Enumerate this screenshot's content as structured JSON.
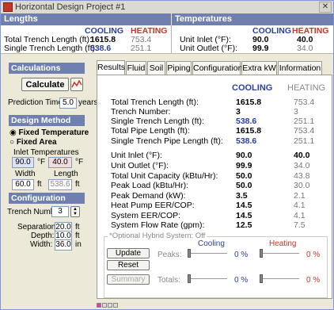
{
  "window": {
    "title": "Horizontal Design Project #1",
    "close_label": "✕"
  },
  "summary": {
    "lengths_header": "Lengths",
    "temps_header": "Temperatures",
    "cooling_label": "COOLING",
    "heating_label": "HEATING",
    "total_trench_label": "Total Trench Length (ft):",
    "total_trench_cool": "1615.8",
    "total_trench_heat": "753.4",
    "single_trench_label": "Single Trench Length (ft):",
    "single_trench_cool": "538.6",
    "single_trench_heat": "251.1",
    "unit_inlet_label": "Unit Inlet (°F):",
    "unit_inlet_cool": "90.0",
    "unit_inlet_heat": "40.0",
    "unit_outlet_label": "Unit Outlet (°F):",
    "unit_outlet_cool": "99.9",
    "unit_outlet_heat": "34.0"
  },
  "left": {
    "calculations_header": "Calculations",
    "calculate_label": "Calculate",
    "prediction_label": "Prediction Time:",
    "prediction_value": "5.0",
    "prediction_unit": "years",
    "design_method_header": "Design Method",
    "fixed_temperature": "Fixed Temperature",
    "fixed_area": "Fixed Area",
    "inlet_temps_label": "Inlet Temperatures",
    "inlet_cool": "90.0",
    "inlet_heat": "40.0",
    "deg_unit": "°F",
    "width_label": "Width",
    "length_label": "Length",
    "width_value": "60.0",
    "length_value": "538.6",
    "ft_unit": "ft",
    "configuration_header": "Configuration",
    "trench_number_label": "Trench Number:",
    "trench_number_value": "3",
    "separation_label": "Separation:",
    "separation_value": "20.0",
    "depth_label": "Depth:",
    "depth_value": "10.0",
    "width2_label": "Width:",
    "width2_value": "36.0",
    "in_unit": "in"
  },
  "tabs": [
    "Results",
    "Fluid",
    "Soil",
    "Piping",
    "Configuration",
    "Extra kW",
    "Information"
  ],
  "results": {
    "cooling_header": "COOLING",
    "heating_header": "HEATING",
    "rows": [
      {
        "label": "Total Trench Length (ft):",
        "cool": "1615.8",
        "heat": "753.4"
      },
      {
        "label": "Trench Number:",
        "cool": "3",
        "heat": "3"
      },
      {
        "label": "Single Trench Length (ft):",
        "cool": "538.6",
        "heat": "251.1"
      },
      {
        "label": "Total Pipe Length (ft):",
        "cool": "1615.8",
        "heat": "753.4"
      },
      {
        "label": "Single Trench Pipe Length (ft):",
        "cool": "538.6",
        "heat": "251.1"
      },
      {
        "label": "Unit Inlet (°F):",
        "cool": "90.0",
        "heat": "40.0"
      },
      {
        "label": "Unit Outlet (°F):",
        "cool": "99.9",
        "heat": "34.0"
      },
      {
        "label": "Total Unit Capacity (kBtu/Hr):",
        "cool": "50.0",
        "heat": "43.8"
      },
      {
        "label": "Peak Load (kBtu/Hr):",
        "cool": "50.0",
        "heat": "30.0"
      },
      {
        "label": "Peak Demand (kW):",
        "cool": "3.5",
        "heat": "2.1"
      },
      {
        "label": "Heat Pump EER/COP:",
        "cool": "14.5",
        "heat": "4.1"
      },
      {
        "label": "System EER/COP:",
        "cool": "14.5",
        "heat": "4.1"
      },
      {
        "label": "System Flow Rate (gpm):",
        "cool": "12.5",
        "heat": "7.5"
      }
    ],
    "hybrid": {
      "title": "*Optional Hybrid System: Off",
      "update_label": "Update",
      "reset_label": "Reset",
      "summary_label": "Summary",
      "cooling_label": "Cooling",
      "heating_label": "Heating",
      "peaks_label": "Peaks:",
      "totals_label": "Totals:",
      "peaks_cool_pct": "0 %",
      "peaks_heat_pct": "0 %",
      "totals_cool_pct": "0 %",
      "totals_heat_pct": "0 %"
    }
  },
  "colors": {
    "cooling": "#2b3fa0",
    "heating": "#c0392b",
    "header_bg": "#6f80b0"
  }
}
